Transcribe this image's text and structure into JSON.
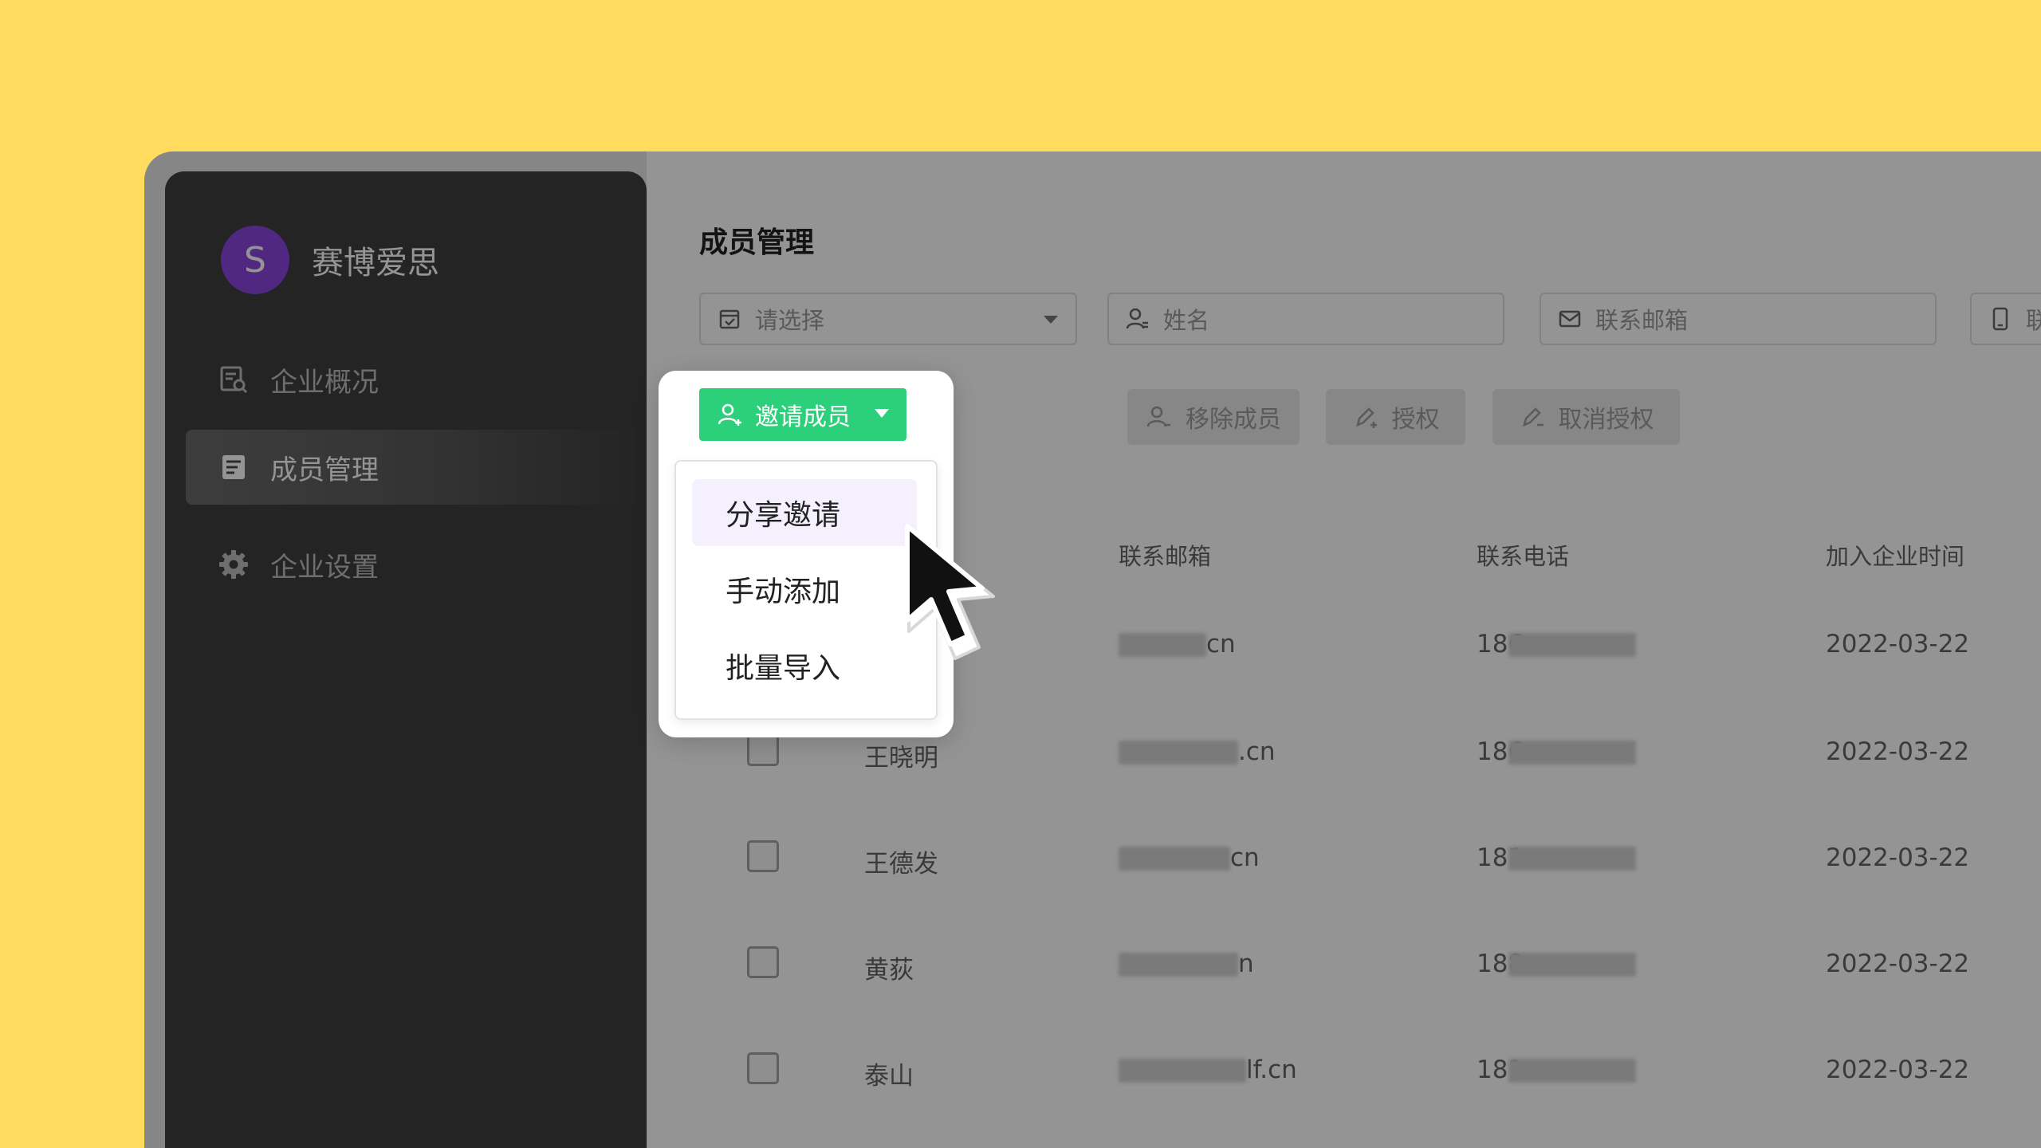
{
  "brand": {
    "initial": "S",
    "name": "赛博爱思",
    "avatar_color": "#8A45DE"
  },
  "sidebar": {
    "items": [
      {
        "label": "企业概况",
        "icon": "enterprise-overview-icon",
        "active": false
      },
      {
        "label": "成员管理",
        "icon": "member-list-icon",
        "active": true
      },
      {
        "label": "企业设置",
        "icon": "gear-icon",
        "active": false
      }
    ]
  },
  "main": {
    "title": "成员管理",
    "filters": [
      {
        "placeholder": "请选择",
        "icon": "checkbox-calendar-icon",
        "type": "select"
      },
      {
        "placeholder": "姓名",
        "icon": "user-icon",
        "type": "input"
      },
      {
        "placeholder": "联系邮箱",
        "icon": "mail-icon",
        "type": "input"
      },
      {
        "placeholder": "联",
        "icon": "phone-icon",
        "type": "input"
      }
    ],
    "actions": {
      "invite": "邀请成员",
      "remove": "移除成员",
      "authorize": "授权",
      "revoke": "取消授权"
    },
    "invite_menu": [
      "分享邀请",
      "手动添加",
      "批量导入"
    ],
    "table": {
      "headers": {
        "email": "联系邮箱",
        "phone": "联系电话",
        "joined": "加入企业时间"
      },
      "rows": [
        {
          "name": "",
          "email_suffix": "cn",
          "phone_prefix": "186",
          "joined": "2022-03-22"
        },
        {
          "name": "王晓明",
          "email_suffix": ".cn",
          "phone_prefix": "186",
          "joined": "2022-03-22"
        },
        {
          "name": "王德发",
          "email_suffix": "cn",
          "phone_prefix": "181",
          "joined": "2022-03-22"
        },
        {
          "name": "黄荻",
          "email_suffix": "n",
          "phone_prefix": "188",
          "joined": "2022-03-22"
        },
        {
          "name": "泰山",
          "email_suffix": "lf.cn",
          "phone_prefix": "181",
          "joined": "2022-03-22"
        }
      ]
    }
  },
  "colors": {
    "accent": "#2DD07A",
    "background": "#FFDB5E",
    "sidebar": "#3e3e3e",
    "menu_hover": "#F5F0FD"
  }
}
